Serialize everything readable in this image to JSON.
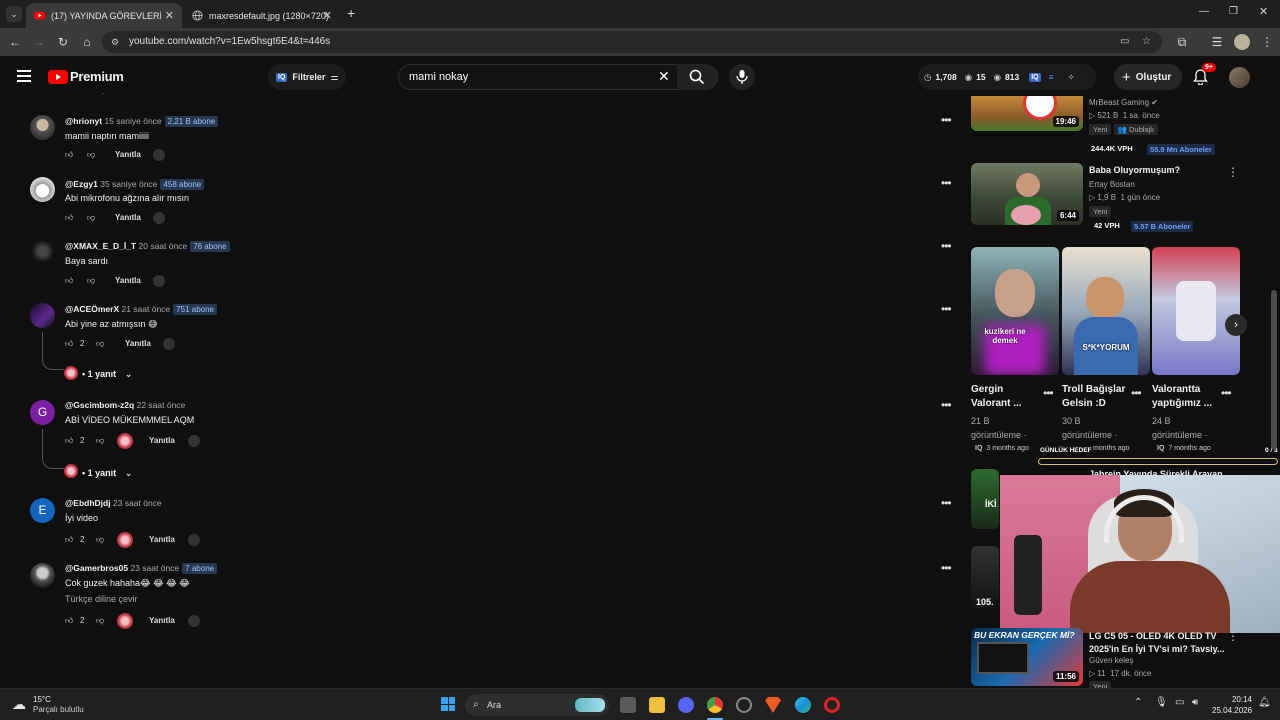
{
  "browser": {
    "tabs": [
      {
        "title": "(17) YAYINDA GÖREVLERİ YAP :",
        "active": true
      },
      {
        "title": "maxresdefault.jpg (1280×720)",
        "active": false
      }
    ],
    "new_tab": "+",
    "url": "youtube.com/watch?v=1Ew5hsgt6E4&t=446s"
  },
  "youtube": {
    "logo": "Premium",
    "filters_label": "Filtreler",
    "search_value": "mami nokay",
    "stats": {
      "watching": "1,708",
      "likes": "15",
      "views": "813"
    },
    "create_label": "Oluştur",
    "notif_count": "9+"
  },
  "comments": [
    {
      "user": "@hrionyt",
      "time": "15 saniye önce",
      "subs": "2,21 B abone",
      "text": "mamii naptın mamiiiii",
      "likes": "",
      "reply": "Yanıtla"
    },
    {
      "user": "@Ezgy1",
      "time": "35 saniye önce",
      "subs": "458 abone",
      "text": "Abi mikrofonu ağzına alır mısın",
      "likes": "",
      "reply": "Yanıtla"
    },
    {
      "user": "@XMAX_E_D_İ_T",
      "time": "20 saat önce",
      "subs": "76 abone",
      "text": "Baya sardı",
      "likes": "",
      "reply": "Yanıtla"
    },
    {
      "user": "@ACEÖmerX",
      "time": "21 saat önce",
      "subs": "751 abone",
      "text": "Abi yine az atmışsın 😅",
      "likes": "2",
      "reply": "Yanıtla",
      "replies": "1 yanıt"
    },
    {
      "user": "@Gscimbom-z2q",
      "time": "22 saat önce",
      "subs": "",
      "text": "ABİ VİDEO MÜKEMMMEL AQM",
      "likes": "2",
      "reply": "Yanıtla",
      "replies": "1 yanıt",
      "avatar_letter": "G"
    },
    {
      "user": "@EbdhDjdj",
      "time": "23 saat önce",
      "subs": "",
      "text": "İyi video",
      "likes": "2",
      "reply": "Yanıtla",
      "avatar_letter": "E"
    },
    {
      "user": "@Gamerbros05",
      "time": "23 saat önce",
      "subs": "7 abone",
      "text": "Cok guzek hahaha😂 😂 😂 😂",
      "translate": "Türkçe diline çevir",
      "likes": "2",
      "reply": "Yanıtla"
    }
  ],
  "related": [
    {
      "channel": "MrBeast Gaming",
      "views": "521 B",
      "age": "1 sa. önce",
      "tags": [
        "Yeni",
        "Dublajlı"
      ],
      "vph": "244.4K VPH",
      "subs": "55.9 Mn Aboneler",
      "duration": "19:46"
    },
    {
      "title": "Baba Oluyormuşum?",
      "channel": "Ertay Bostan",
      "views": "1,9 B",
      "age": "1 gün önce",
      "tags": [
        "Yeni"
      ],
      "vph": "42 VPH",
      "subs": "5.57 B Aboneler",
      "duration": "6:44"
    }
  ],
  "shorts": [
    {
      "title_l1": "Gergin",
      "title_l2": "Valorant ...",
      "views": "21 B",
      "views_label": "görüntüleme ·",
      "age": "3 months ago",
      "overlay": "kuzikeri ne demek"
    },
    {
      "title_l1": "Troll Bağışlar",
      "title_l2": "Gelsin :D",
      "views": "30 B",
      "views_label": "görüntüleme ·",
      "age": "months ago",
      "overlay": "S*K*YORUM"
    },
    {
      "title_l1": "Valorantta",
      "title_l2": "yaptığımız ...",
      "views": "24 B",
      "views_label": "görüntüleme ·",
      "age": "7 months ago"
    }
  ],
  "overlay": {
    "daily_label": "GÜNLÜK HEDEF",
    "counter": "0 / 3",
    "partial_title": "Jahrein Yayında Sürekli Arayan..."
  },
  "related_bottom": {
    "title_l1": "LG C5 05 - OLED 4K OLED TV",
    "title_l2": "2025'in En İyi TV'si mi? Tavsiy...",
    "channel": "Güven keleş",
    "views": "11",
    "age": "17 dk. önce",
    "tag": "Yeni",
    "duration": "11:56",
    "thumb_text": "BU EKRAN GERÇEK Mİ?",
    "thumb_side": "105.",
    "thumb_side2": "İKİ"
  },
  "taskbar": {
    "temp": "15°C",
    "weather": "Parçalı bulutlu",
    "search": "Ara",
    "time": "20:14",
    "date": "25.04.2026"
  }
}
